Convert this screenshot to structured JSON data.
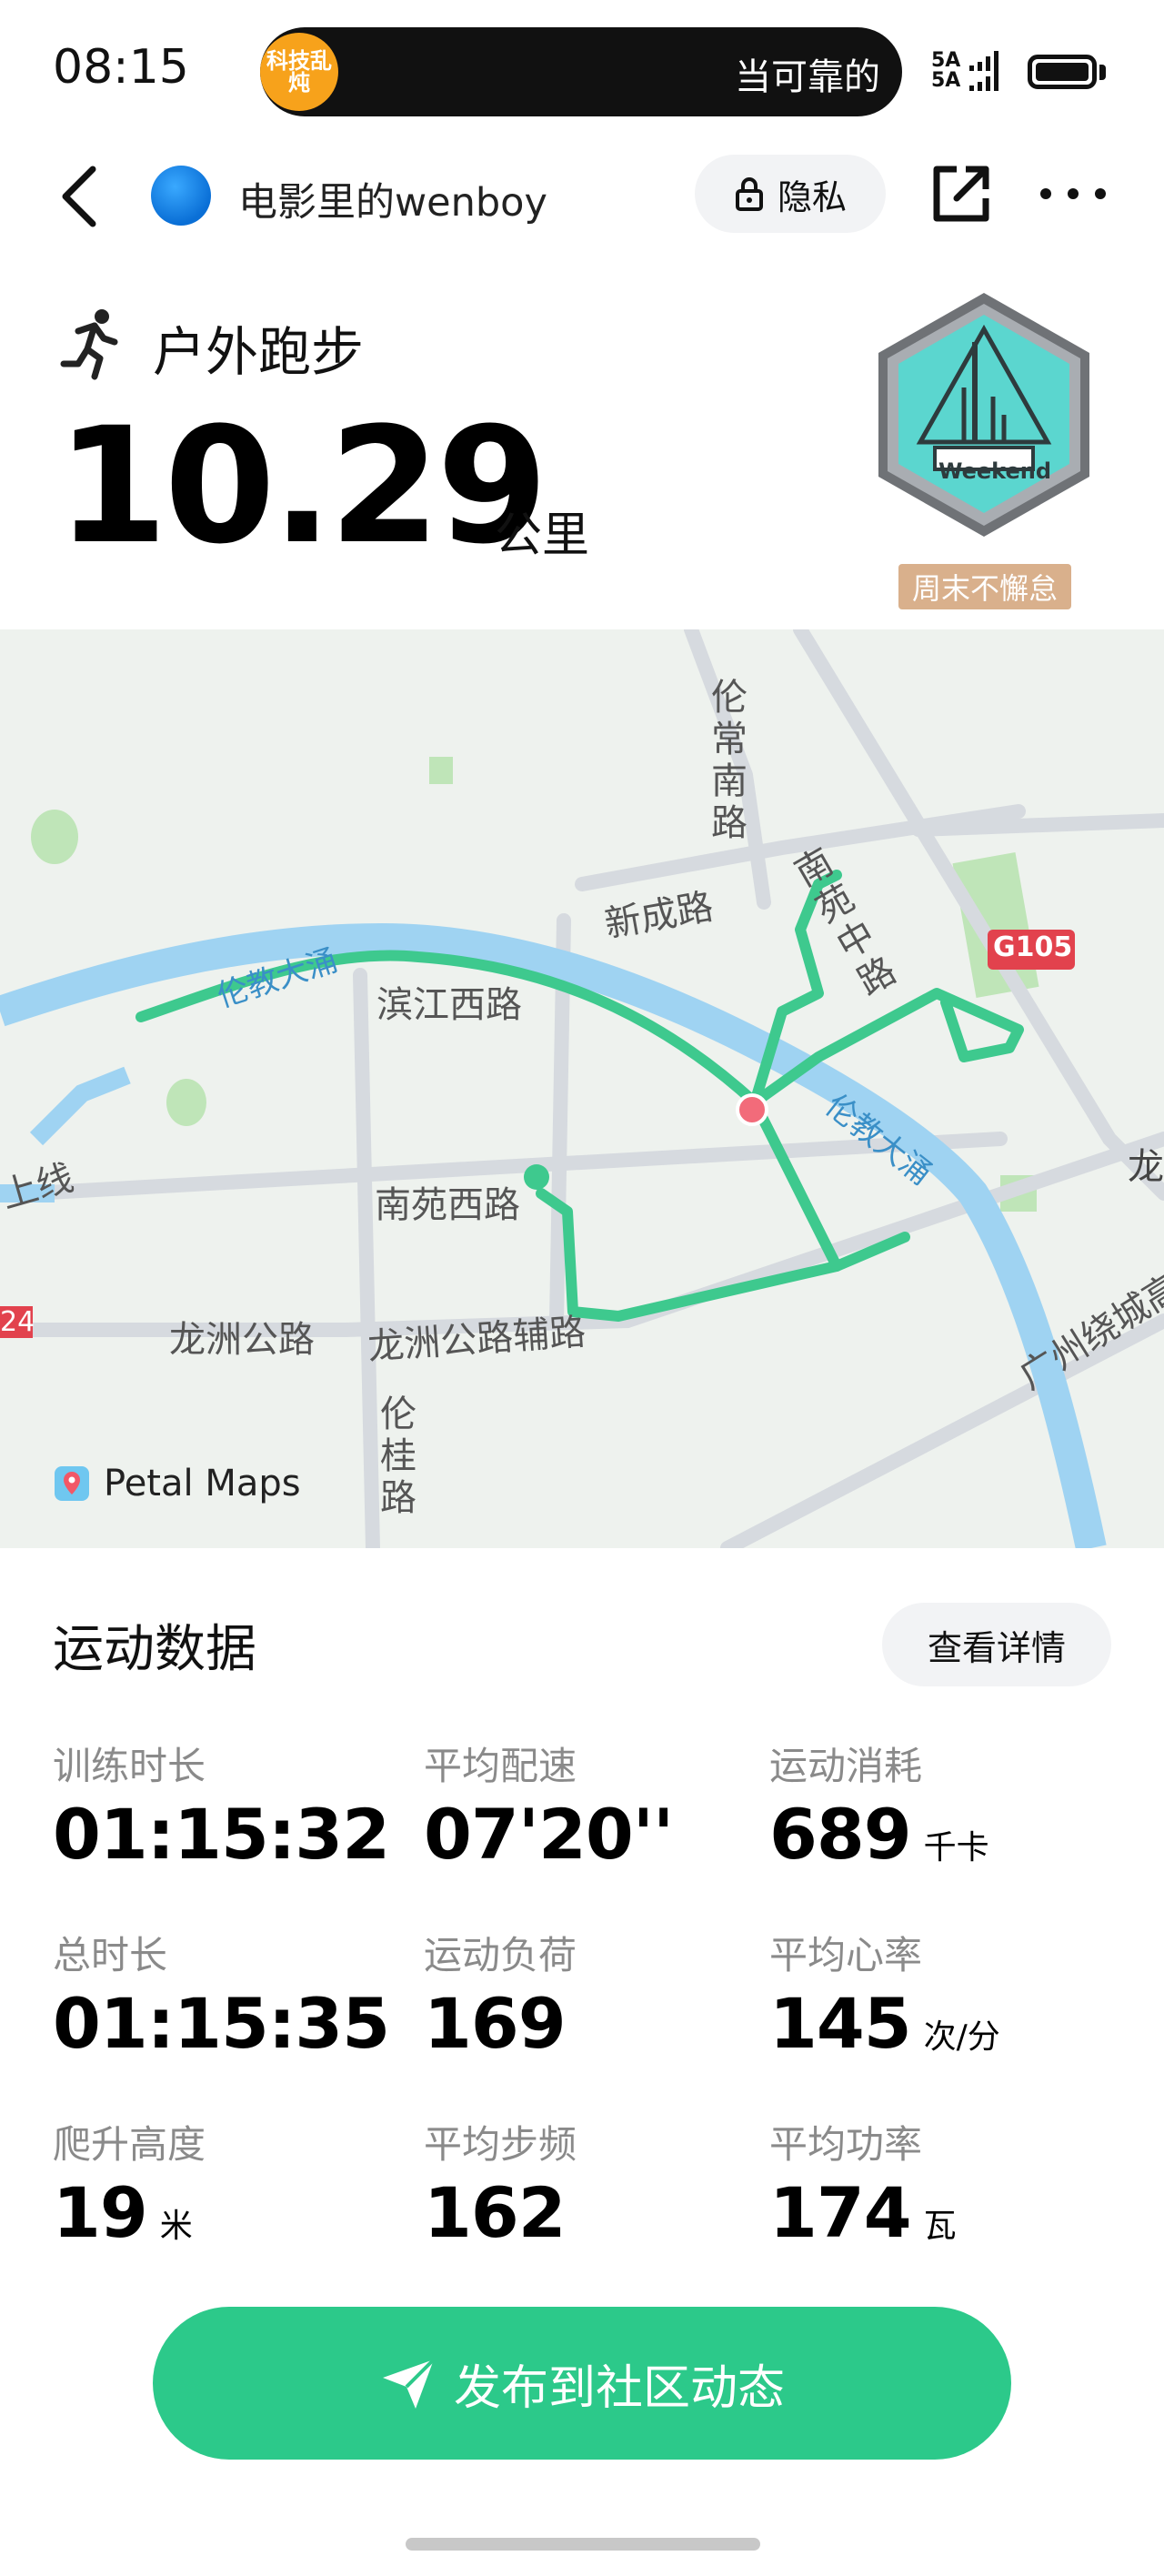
{
  "status_bar": {
    "time": "08:15",
    "island_app_label": "科技乱炖",
    "island_text": "当可靠的",
    "signal_top": "5A",
    "signal_bottom": "5A"
  },
  "nav": {
    "username": "电影里的wenboy",
    "privacy_label": "隐私"
  },
  "workout": {
    "sport_name": "户外跑步",
    "distance": "10.29",
    "distance_unit": "公里",
    "badge_text": "Weekend",
    "badge_caption": "周末不懈怠"
  },
  "map": {
    "provider": "Petal Maps",
    "labels": {
      "river_west": "伦教大涌",
      "river_east": "伦教大涌",
      "binjiang": "滨江西路",
      "xincheng": "新成路",
      "lunchang": "伦常南路",
      "nanyuan_mid": "南苑中路",
      "nanyuan_west": "南苑西路",
      "longzhou": "龙洲公路",
      "longzhou_aux": "龙洲公路辅路",
      "lungui": "伦桂路",
      "ring": "广州绕城高",
      "g105": "G105",
      "long_edge": "龙",
      "shangxian": "上线",
      "road24": "24"
    },
    "colors": {
      "route": "#3ec98e",
      "river": "#9fd3f2",
      "road": "#d9dde2",
      "park": "#bfe5b8"
    }
  },
  "stats": {
    "title": "运动数据",
    "details_label": "查看详情",
    "items": [
      {
        "label": "训练时长",
        "value": "01:15:32",
        "unit": ""
      },
      {
        "label": "平均配速",
        "value": "07'20''",
        "unit": ""
      },
      {
        "label": "运动消耗",
        "value": "689",
        "unit": "千卡"
      },
      {
        "label": "总时长",
        "value": "01:15:35",
        "unit": ""
      },
      {
        "label": "运动负荷",
        "value": "169",
        "unit": ""
      },
      {
        "label": "平均心率",
        "value": "145",
        "unit": "次/分"
      },
      {
        "label": "爬升高度",
        "value": "19",
        "unit": "米"
      },
      {
        "label": "平均步频",
        "value": "162",
        "unit": ""
      },
      {
        "label": "平均功率",
        "value": "174",
        "unit": "瓦"
      }
    ]
  },
  "publish": {
    "label": "发布到社区动态"
  },
  "theme": {
    "accent": "#2cc98a",
    "badge_caption_bg": "#d9b08c"
  }
}
